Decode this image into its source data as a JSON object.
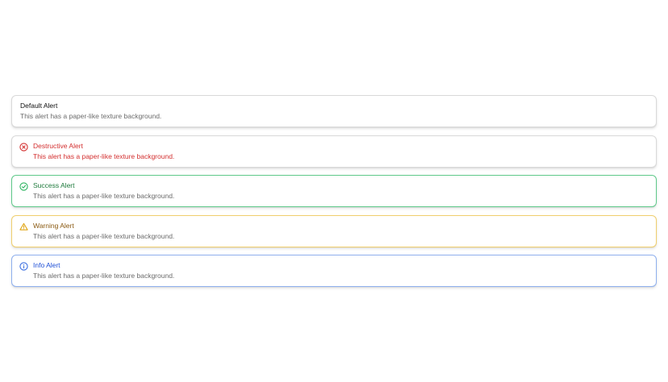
{
  "alerts": [
    {
      "variant": "default",
      "title": "Default Alert",
      "description": "This alert has a paper-like texture background."
    },
    {
      "variant": "destructive",
      "icon": "x-circle-icon",
      "title": "Destructive Alert",
      "description": "This alert has a paper-like texture background."
    },
    {
      "variant": "success",
      "icon": "check-circle-icon",
      "title": "Success Alert",
      "description": "This alert has a paper-like texture background."
    },
    {
      "variant": "warning",
      "icon": "alert-triangle-icon",
      "title": "Warning Alert",
      "description": "This alert has a paper-like texture background."
    },
    {
      "variant": "info",
      "icon": "info-circle-icon",
      "title": "Info Alert",
      "description": "This alert has a paper-like texture background."
    }
  ],
  "colors": {
    "destructive": "#d32f2f",
    "success": "#2bb35f",
    "warning": "#e0a514",
    "info": "#3b6fe0",
    "muted_text": "#6b6b6b"
  }
}
